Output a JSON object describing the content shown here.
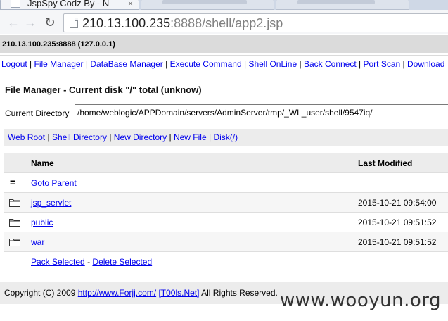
{
  "browser": {
    "tab_title": "JspSpy Codz By - N",
    "url_host": "210.13.100.235",
    "url_rest": ":8888/shell/app2.jsp"
  },
  "page": {
    "host_info": "210.13.100.235:8888 (127.0.0.1)",
    "menu": [
      "Logout",
      "File Manager",
      "DataBase Manager",
      "Execute Command",
      "Shell OnLine",
      "Back Connect",
      "Port Scan",
      "Download"
    ],
    "menu_separator": "|",
    "file_manager_title": "File Manager - Current disk \"/\" total (unknow)",
    "current_directory_label": "Current Directory",
    "current_directory_value": "/home/weblogic/APPDomain/servers/AdminServer/tmp/_WL_user/shell/9547iq/",
    "actions": [
      "Web Root",
      "Shell Directory",
      "New Directory",
      "New File",
      "Disk(/)"
    ],
    "table": {
      "col_name": "Name",
      "col_modified": "Last Modified",
      "parent_glyph": "=",
      "parent_label": "Goto Parent",
      "rows": [
        {
          "name": "jsp_servlet",
          "modified": "2015-10-21 09:54:00"
        },
        {
          "name": "public",
          "modified": "2015-10-21 09:51:52"
        },
        {
          "name": "war",
          "modified": "2015-10-21 09:51:52"
        }
      ],
      "pack_selected": "Pack Selected",
      "dash": "-",
      "delete_selected": "Delete Selected"
    },
    "copyright_prefix": "Copyright (C) 2009",
    "copyright_link1": "http://www.Forjj.com/",
    "copyright_link2": "[T00ls.Net]",
    "copyright_suffix": "All Rights Reserved."
  },
  "watermark": "www.wooyun.org"
}
